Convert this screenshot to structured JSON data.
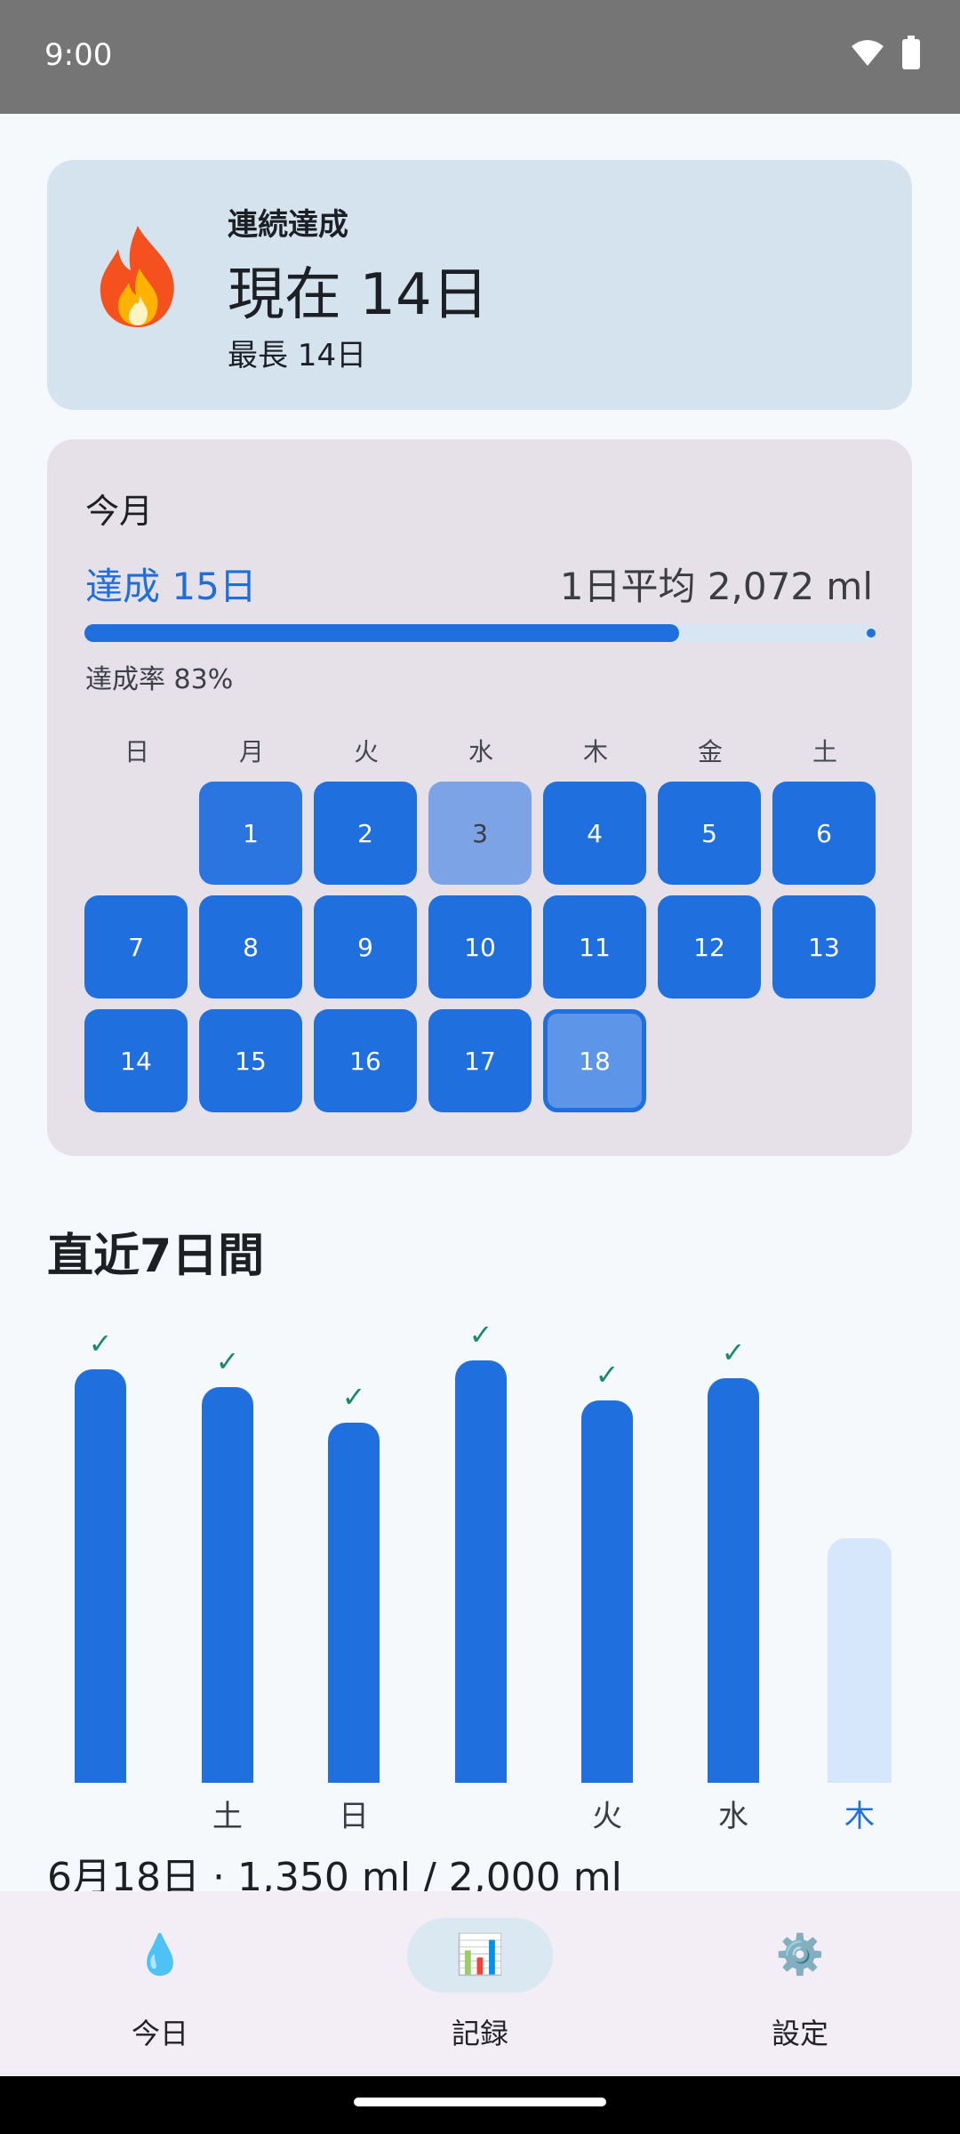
{
  "status_bar": {
    "time": "9:00"
  },
  "streak": {
    "label": "連続達成",
    "current": "現在 14日",
    "best": "最長 14日"
  },
  "month": {
    "title": "今月",
    "achieved": "達成 15日",
    "average": "1日平均 2,072 ml",
    "rate_text": "達成率 83%",
    "rate_percent": 83,
    "weekdays": [
      "日",
      "月",
      "火",
      "水",
      "木",
      "金",
      "土"
    ],
    "days": [
      {
        "d": "1",
        "state": "lighter"
      },
      {
        "d": "2",
        "state": "full"
      },
      {
        "d": "3",
        "state": "partial"
      },
      {
        "d": "4",
        "state": "full"
      },
      {
        "d": "5",
        "state": "full"
      },
      {
        "d": "6",
        "state": "full"
      },
      {
        "d": "7",
        "state": "full"
      },
      {
        "d": "8",
        "state": "full"
      },
      {
        "d": "9",
        "state": "full"
      },
      {
        "d": "10",
        "state": "full"
      },
      {
        "d": "11",
        "state": "full"
      },
      {
        "d": "12",
        "state": "full"
      },
      {
        "d": "13",
        "state": "full"
      },
      {
        "d": "14",
        "state": "full"
      },
      {
        "d": "15",
        "state": "full"
      },
      {
        "d": "16",
        "state": "full"
      },
      {
        "d": "17",
        "state": "full"
      },
      {
        "d": "18",
        "state": "today"
      }
    ],
    "first_weekday_index": 1
  },
  "week": {
    "title": "直近7日間",
    "bars": [
      {
        "label": "",
        "level": 0.93,
        "achieved": true,
        "today": false
      },
      {
        "label": "土",
        "level": 0.89,
        "achieved": true,
        "today": false
      },
      {
        "label": "日",
        "level": 0.81,
        "achieved": true,
        "today": false
      },
      {
        "label": "",
        "level": 0.95,
        "achieved": true,
        "today": false
      },
      {
        "label": "火",
        "level": 0.86,
        "achieved": true,
        "today": false
      },
      {
        "label": "水",
        "level": 0.91,
        "achieved": true,
        "today": false
      },
      {
        "label": "木",
        "level": 0.55,
        "achieved": false,
        "today": true
      }
    ]
  },
  "summary": "6月18日 · 1,350 ml / 2,000 ml",
  "nav": {
    "items": [
      {
        "label": "今日",
        "icon": "💧"
      },
      {
        "label": "記録",
        "icon": "📊"
      },
      {
        "label": "設定",
        "icon": "⚙️"
      }
    ]
  },
  "colors": {
    "accent": "#1f6fde",
    "streak_card": "#d5e3ef",
    "month_card": "#e6e1e8",
    "today_bar": "#d6e6fb",
    "check": "#1b8a6b"
  }
}
